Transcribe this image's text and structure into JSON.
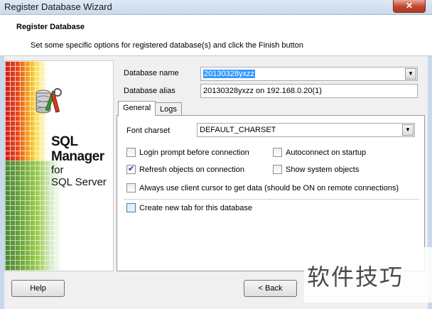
{
  "window": {
    "title": "Register Database Wizard",
    "close_glyph": "✕"
  },
  "header": {
    "title": "Register Database",
    "description": "Set some specific options for registered database(s) and click the Finish button"
  },
  "brand": {
    "line1": "SQL",
    "line2": "Manager",
    "line3": "for",
    "line4": "SQL Server"
  },
  "fields": {
    "db_name_label": "Database name",
    "db_name_value": "20130328yxzz",
    "db_alias_label": "Database alias",
    "db_alias_value": "20130328yxzz on 192.168.0.20(1)"
  },
  "tabs": [
    {
      "label": "General",
      "active": true
    },
    {
      "label": "Logs",
      "active": false
    }
  ],
  "general": {
    "font_charset_label": "Font charset",
    "font_charset_value": "DEFAULT_CHARSET",
    "options": [
      {
        "label": "Login prompt before connection",
        "checked": false
      },
      {
        "label": "Autoconnect on startup",
        "checked": false
      },
      {
        "label": "Refresh objects on connection",
        "checked": true
      },
      {
        "label": "Show system objects",
        "checked": false
      },
      {
        "label": "Always use client cursor to get data (should be ON on remote connections)",
        "checked": false
      },
      {
        "label": "Create new tab for this database",
        "checked": false
      }
    ]
  },
  "buttons": {
    "help": "Help",
    "back": "< Back"
  },
  "watermark": "软件技巧",
  "icons": {
    "combo_arrow": "▼",
    "database": "database-icon"
  }
}
